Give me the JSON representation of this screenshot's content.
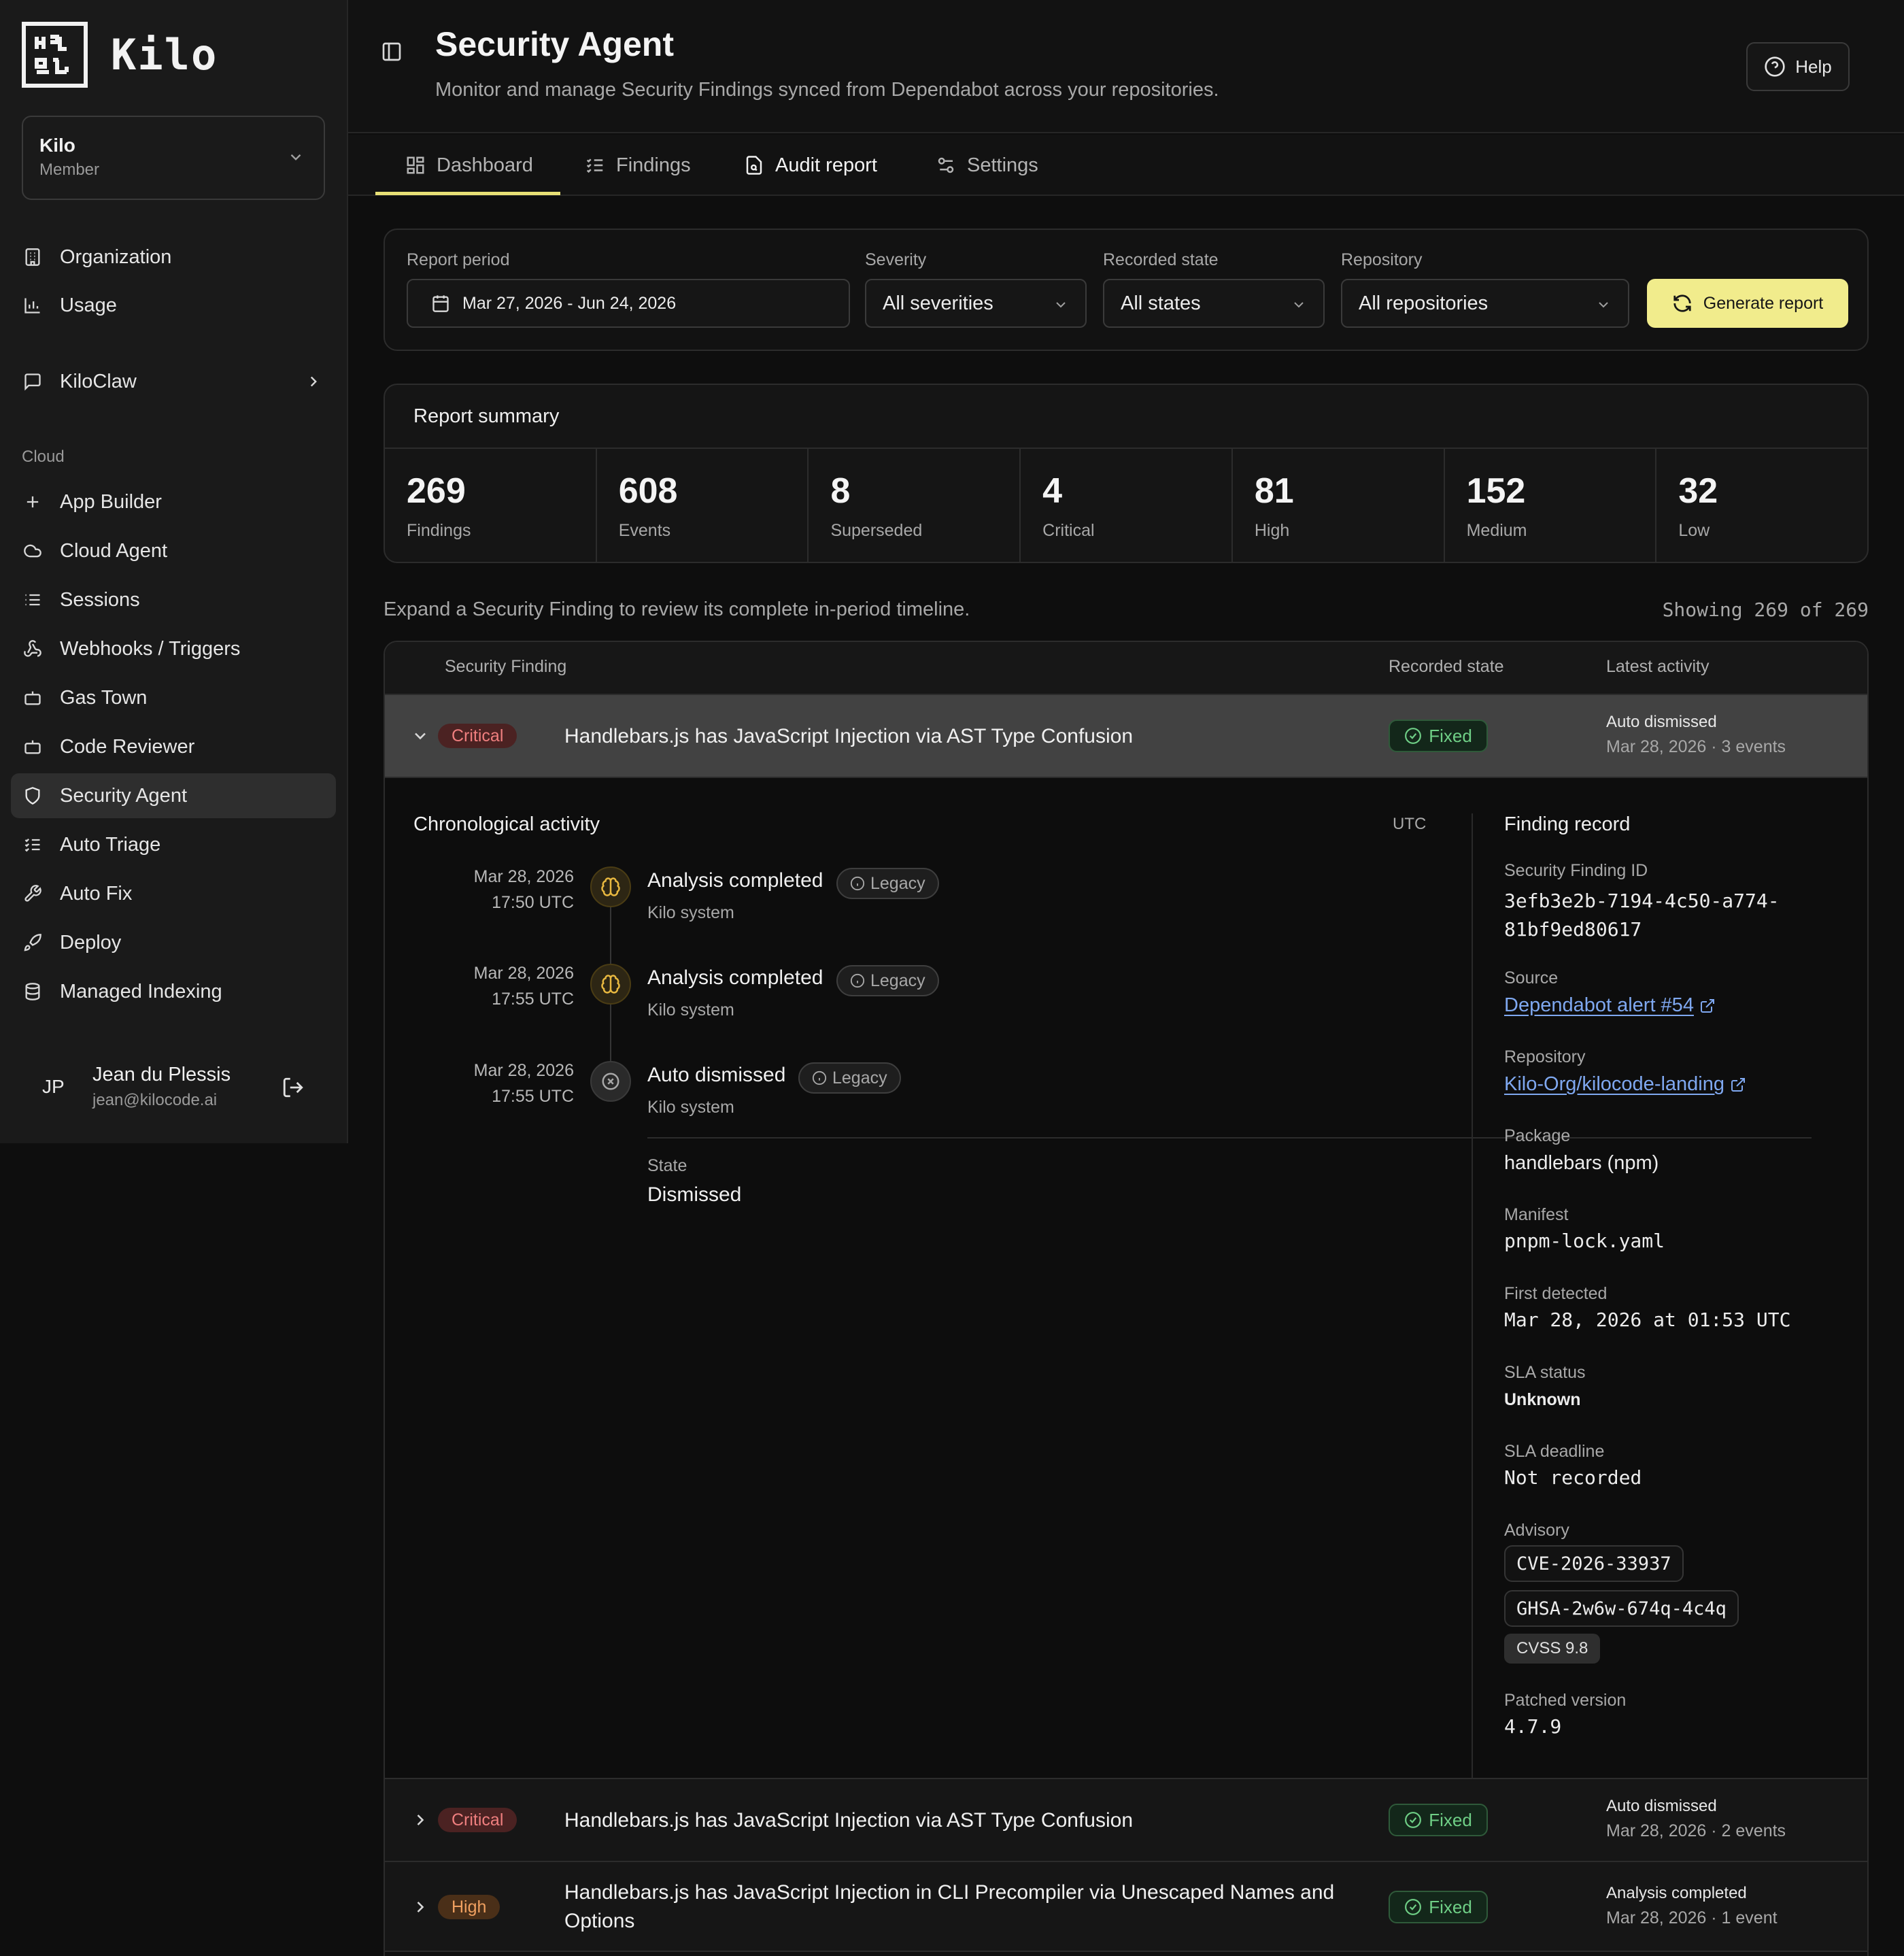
{
  "app": {
    "logo_text": "Kilo"
  },
  "org": {
    "name": "Kilo",
    "role": "Member"
  },
  "nav": {
    "top": [
      {
        "label": "Organization",
        "icon": "building-icon"
      },
      {
        "label": "Usage",
        "icon": "bar-chart-icon"
      }
    ],
    "kiloclaw": {
      "label": "KiloClaw",
      "icon": "message-square-icon"
    },
    "section_label": "Cloud",
    "cloud": [
      {
        "label": "App Builder",
        "icon": "plus-icon"
      },
      {
        "label": "Cloud Agent",
        "icon": "cloud-icon"
      },
      {
        "label": "Sessions",
        "icon": "list-icon"
      },
      {
        "label": "Webhooks / Triggers",
        "icon": "webhook-icon"
      },
      {
        "label": "Gas Town",
        "icon": "bot-icon"
      },
      {
        "label": "Code Reviewer",
        "icon": "bot-icon"
      },
      {
        "label": "Security Agent",
        "icon": "shield-icon",
        "active": true
      },
      {
        "label": "Auto Triage",
        "icon": "list-checks-icon"
      },
      {
        "label": "Auto Fix",
        "icon": "wrench-icon"
      },
      {
        "label": "Deploy",
        "icon": "rocket-icon"
      },
      {
        "label": "Managed Indexing",
        "icon": "database-icon"
      }
    ]
  },
  "user": {
    "initials": "JP",
    "name": "Jean du Plessis",
    "email": "jean@kilocode.ai"
  },
  "header": {
    "title": "Security Agent",
    "subtitle": "Monitor and manage Security Findings synced from Dependabot across your repositories.",
    "help_label": "Help"
  },
  "tabs": [
    {
      "label": "Dashboard",
      "icon": "grid-icon"
    },
    {
      "label": "Findings",
      "icon": "list-checks-icon"
    },
    {
      "label": "Audit report",
      "icon": "file-search-icon",
      "active": true
    },
    {
      "label": "Settings",
      "icon": "sliders-icon"
    }
  ],
  "filters": {
    "period_label": "Report period",
    "period_value": "Mar 27, 2026 - Jun 24, 2026",
    "severity_label": "Severity",
    "severity_value": "All severities",
    "state_label": "Recorded state",
    "state_value": "All states",
    "repo_label": "Repository",
    "repo_value": "All repositories",
    "generate_label": "Generate report"
  },
  "summary": {
    "title": "Report summary",
    "stats": [
      {
        "value": "269",
        "label": "Findings"
      },
      {
        "value": "608",
        "label": "Events"
      },
      {
        "value": "8",
        "label": "Superseded"
      },
      {
        "value": "4",
        "label": "Critical"
      },
      {
        "value": "81",
        "label": "High"
      },
      {
        "value": "152",
        "label": "Medium"
      },
      {
        "value": "32",
        "label": "Low"
      }
    ]
  },
  "list": {
    "hint": "Expand a Security Finding to review its complete in-period timeline.",
    "showing": "Showing 269 of 269",
    "columns": {
      "finding": "Security Finding",
      "state": "Recorded state",
      "latest": "Latest activity"
    },
    "rows": [
      {
        "severity": "Critical",
        "title": "Handlebars.js has JavaScript Injection via AST Type Confusion",
        "state": "Fixed",
        "latest_title": "Auto dismissed",
        "latest_sub": "Mar 28, 2026 · 3 events"
      },
      {
        "severity": "Critical",
        "title": "Handlebars.js has JavaScript Injection via AST Type Confusion",
        "state": "Fixed",
        "latest_title": "Auto dismissed",
        "latest_sub": "Mar 28, 2026 · 2 events"
      },
      {
        "severity": "High",
        "title_line1": "Handlebars.js has JavaScript Injection in CLI Precompiler via Unescaped Names and",
        "title_line2": "Options",
        "state": "Fixed",
        "latest_title": "Analysis completed",
        "latest_sub": "Mar 28, 2026 · 1 event"
      }
    ]
  },
  "detail": {
    "chron_title": "Chronological activity",
    "tz": "UTC",
    "events": [
      {
        "date": "Mar 28, 2026",
        "time": "17:50 UTC",
        "title": "Analysis completed",
        "badge": "Legacy",
        "by": "Kilo system"
      },
      {
        "date": "Mar 28, 2026",
        "time": "17:55 UTC",
        "title": "Analysis completed",
        "badge": "Legacy",
        "by": "Kilo system"
      },
      {
        "date": "Mar 28, 2026",
        "time": "17:55 UTC",
        "title": "Auto dismissed",
        "badge": "Legacy",
        "by": "Kilo system"
      }
    ],
    "state_label": "State",
    "state_value": "Dismissed",
    "record": {
      "title": "Finding record",
      "id_label": "Security Finding ID",
      "id_line1": "3efb3e2b-7194-4c50-a774-",
      "id_line2": "81bf9ed80617",
      "source_label": "Source",
      "source_value": "Dependabot alert #54",
      "repo_label": "Repository",
      "repo_value": "Kilo-Org/kilocode-landing",
      "package_label": "Package",
      "package_value": "handlebars (npm)",
      "manifest_label": "Manifest",
      "manifest_value": "pnpm-lock.yaml",
      "first_label": "First detected",
      "first_value": "Mar 28, 2026 at 01:53 UTC",
      "sla_status_label": "SLA status",
      "sla_status_value": "Unknown",
      "sla_deadline_label": "SLA deadline",
      "sla_deadline_value": "Not recorded",
      "advisory_label": "Advisory",
      "advisory_cve": "CVE-2026-33937",
      "advisory_ghsa": "GHSA-2w6w-674q-4c4q",
      "advisory_cvss": "CVSS 9.8",
      "patched_label": "Patched version",
      "patched_value": "4.7.9"
    }
  }
}
